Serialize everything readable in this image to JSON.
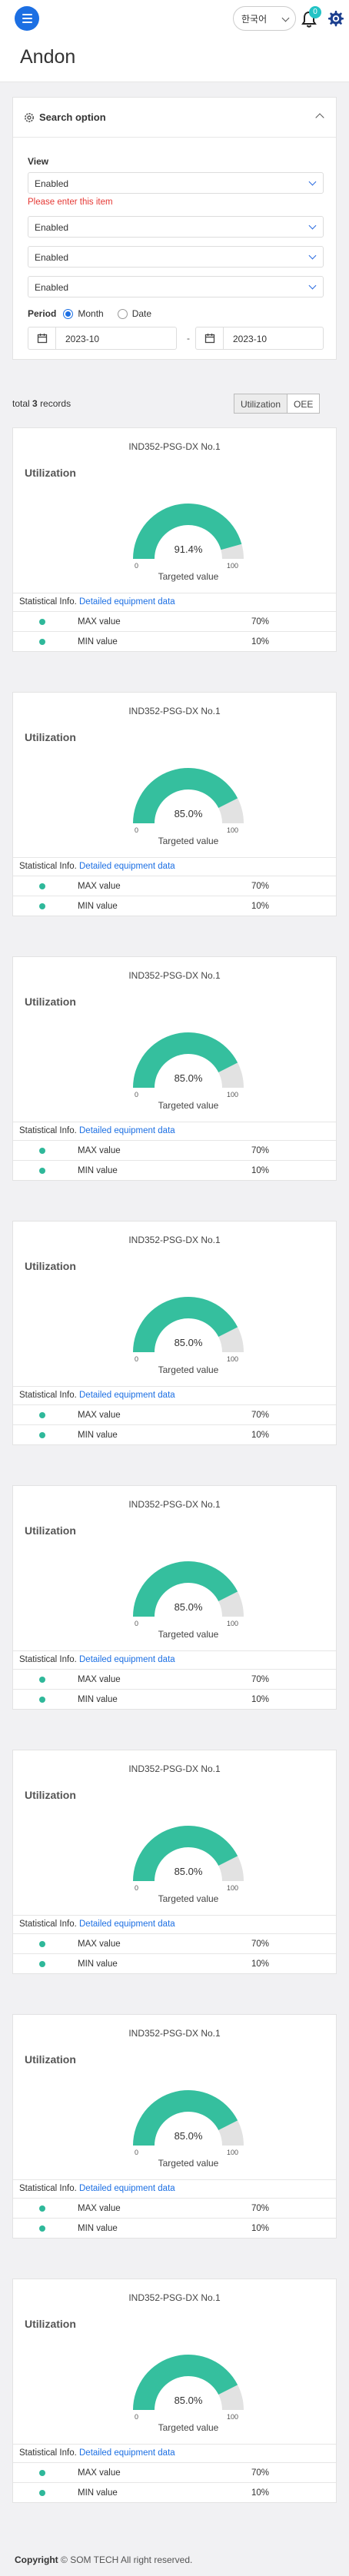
{
  "header": {
    "language": "한국어",
    "notification_count": "0",
    "page_title": "Andon"
  },
  "search": {
    "title": "Search option",
    "view_label": "View",
    "selects": [
      "Enabled",
      "Enabled",
      "Enabled",
      "Enabled"
    ],
    "error": "Please enter this item",
    "period_label": "Period",
    "period_options": [
      "Month",
      "Date"
    ],
    "period_selected": "Month",
    "date_from": "2023-10",
    "date_sep": "-",
    "date_to": "2023-10"
  },
  "records": {
    "prefix": "total",
    "count": "3",
    "suffix": "records",
    "tabs": [
      "Utilization",
      "OEE"
    ],
    "active_tab": "Utilization"
  },
  "cards": [
    {
      "title": "IND352-PSG-DX No.1",
      "subtitle": "Utilization",
      "value": "91.4%",
      "percent": 91.4,
      "min": "0",
      "max": "100",
      "gauge_label": "Targeted value",
      "stat_label": "Statistical Info.",
      "stat_link": "Detailed equipment data",
      "stats": [
        {
          "name": "MAX value",
          "value": "70%"
        },
        {
          "name": "MIN value",
          "value": "10%"
        }
      ]
    },
    {
      "title": "IND352-PSG-DX No.1",
      "subtitle": "Utilization",
      "value": "85.0%",
      "percent": 85.0,
      "min": "0",
      "max": "100",
      "gauge_label": "Targeted value",
      "stat_label": "Statistical Info.",
      "stat_link": "Detailed equipment data",
      "stats": [
        {
          "name": "MAX value",
          "value": "70%"
        },
        {
          "name": "MIN value",
          "value": "10%"
        }
      ]
    },
    {
      "title": "IND352-PSG-DX No.1",
      "subtitle": "Utilization",
      "value": "85.0%",
      "percent": 85.0,
      "min": "0",
      "max": "100",
      "gauge_label": "Targeted value",
      "stat_label": "Statistical Info.",
      "stat_link": "Detailed equipment data",
      "stats": [
        {
          "name": "MAX value",
          "value": "70%"
        },
        {
          "name": "MIN value",
          "value": "10%"
        }
      ]
    },
    {
      "title": "IND352-PSG-DX No.1",
      "subtitle": "Utilization",
      "value": "85.0%",
      "percent": 85.0,
      "min": "0",
      "max": "100",
      "gauge_label": "Targeted value",
      "stat_label": "Statistical Info.",
      "stat_link": "Detailed equipment data",
      "stats": [
        {
          "name": "MAX value",
          "value": "70%"
        },
        {
          "name": "MIN value",
          "value": "10%"
        }
      ]
    },
    {
      "title": "IND352-PSG-DX No.1",
      "subtitle": "Utilization",
      "value": "85.0%",
      "percent": 85.0,
      "min": "0",
      "max": "100",
      "gauge_label": "Targeted value",
      "stat_label": "Statistical Info.",
      "stat_link": "Detailed equipment data",
      "stats": [
        {
          "name": "MAX value",
          "value": "70%"
        },
        {
          "name": "MIN value",
          "value": "10%"
        }
      ]
    },
    {
      "title": "IND352-PSG-DX No.1",
      "subtitle": "Utilization",
      "value": "85.0%",
      "percent": 85.0,
      "min": "0",
      "max": "100",
      "gauge_label": "Targeted value",
      "stat_label": "Statistical Info.",
      "stat_link": "Detailed equipment data",
      "stats": [
        {
          "name": "MAX value",
          "value": "70%"
        },
        {
          "name": "MIN value",
          "value": "10%"
        }
      ]
    },
    {
      "title": "IND352-PSG-DX No.1",
      "subtitle": "Utilization",
      "value": "85.0%",
      "percent": 85.0,
      "min": "0",
      "max": "100",
      "gauge_label": "Targeted value",
      "stat_label": "Statistical Info.",
      "stat_link": "Detailed equipment data",
      "stats": [
        {
          "name": "MAX value",
          "value": "70%"
        },
        {
          "name": "MIN value",
          "value": "10%"
        }
      ]
    },
    {
      "title": "IND352-PSG-DX No.1",
      "subtitle": "Utilization",
      "value": "85.0%",
      "percent": 85.0,
      "min": "0",
      "max": "100",
      "gauge_label": "Targeted value",
      "stat_label": "Statistical Info.",
      "stat_link": "Detailed equipment data",
      "stats": [
        {
          "name": "MAX value",
          "value": "70%"
        },
        {
          "name": "MIN value",
          "value": "10%"
        }
      ]
    }
  ],
  "colors": {
    "gauge_fill": "#35bf9e",
    "gauge_track": "#e2e2e2",
    "primary": "#1c6fe3",
    "badge": "#23c3c5",
    "error": "#e53935"
  },
  "footer": {
    "prefix": "Copyright",
    "text": "© SOM TECH All right reserved."
  }
}
